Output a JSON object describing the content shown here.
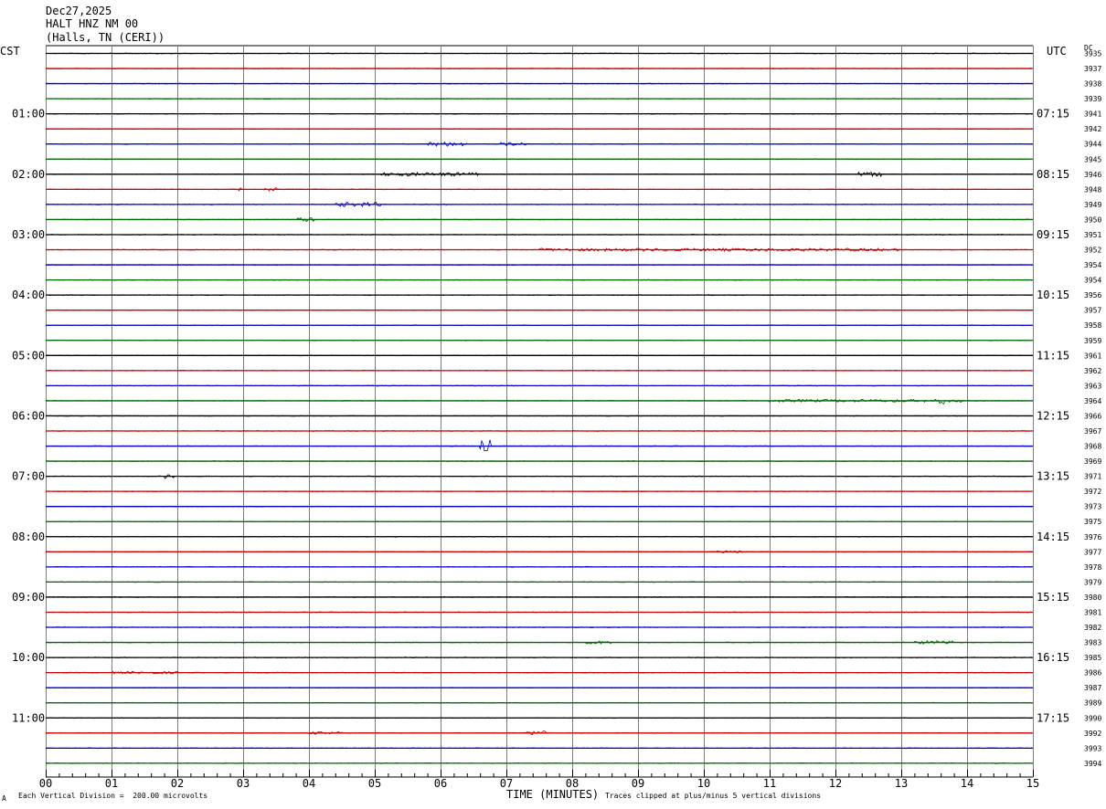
{
  "header": {
    "date": "Dec27,2025",
    "station": "HALT HNZ NM 00",
    "location": "(Halls, TN (CERI))"
  },
  "left_timezone": "CST",
  "right_timezone": "UTC",
  "dc_label": "DC",
  "footer": {
    "scale_note": "Each Vertical Division =  200.00 microvolts",
    "clip_note": "Traces clipped at plus/minus 5 vertical divisions",
    "corner_mark": "A"
  },
  "colors": {
    "trace_cycle": [
      "#000000",
      "#cc0000",
      "#0000cc",
      "#006600"
    ],
    "grid": "#808080"
  },
  "chart_data": {
    "type": "line",
    "title": "HALT HNZ NM 00",
    "xlabel": "TIME (MINUTES)",
    "x_ticks": [
      "00",
      "01",
      "02",
      "03",
      "04",
      "05",
      "06",
      "07",
      "08",
      "09",
      "10",
      "11",
      "12",
      "13",
      "14",
      "15"
    ],
    "xlim": [
      0,
      15
    ],
    "rows": 48,
    "minutes_per_row": 15,
    "left_hour_labels": [
      "01:00",
      "02:00",
      "03:00",
      "04:00",
      "05:00",
      "06:00",
      "07:00",
      "08:00",
      "09:00",
      "10:00",
      "11:00"
    ],
    "right_hour_labels": [
      "07:15",
      "08:15",
      "09:15",
      "10:15",
      "11:15",
      "12:15",
      "13:15",
      "14:15",
      "15:15",
      "16:15",
      "17:15"
    ],
    "dc_offsets": [
      3935,
      3937,
      3938,
      3939,
      3941,
      3942,
      3944,
      3945,
      3946,
      3948,
      3949,
      3950,
      3951,
      3952,
      3954,
      3954,
      3956,
      3957,
      3958,
      3959,
      3961,
      3962,
      3963,
      3964,
      3966,
      3967,
      3968,
      3969,
      3971,
      3972,
      3973,
      3975,
      3976,
      3977,
      3978,
      3979,
      3980,
      3981,
      3982,
      3983,
      3985,
      3986,
      3987,
      3989,
      3990,
      3992,
      3993,
      3994
    ],
    "events": [
      {
        "row": 6,
        "start_min": 5.8,
        "end_min": 6.4,
        "amp_px": 2.5
      },
      {
        "row": 6,
        "start_min": 6.9,
        "end_min": 7.3,
        "amp_px": 2
      },
      {
        "row": 8,
        "start_min": 5.1,
        "end_min": 6.6,
        "amp_px": 2
      },
      {
        "row": 8,
        "start_min": 12.3,
        "end_min": 12.7,
        "amp_px": 2.5
      },
      {
        "row": 9,
        "start_min": 2.93,
        "end_min": 2.97,
        "amp_px": 7
      },
      {
        "row": 9,
        "start_min": 3.3,
        "end_min": 3.5,
        "amp_px": 2
      },
      {
        "row": 10,
        "start_min": 4.4,
        "end_min": 5.1,
        "amp_px": 2.5
      },
      {
        "row": 11,
        "start_min": 3.8,
        "end_min": 4.1,
        "amp_px": 2.5
      },
      {
        "row": 13,
        "start_min": 7.5,
        "end_min": 13.0,
        "amp_px": 1.6
      },
      {
        "row": 23,
        "start_min": 11.0,
        "end_min": 14.0,
        "amp_px": 1.5
      },
      {
        "row": 23,
        "start_min": 13.55,
        "end_min": 13.65,
        "amp_px": 4
      },
      {
        "row": 26,
        "start_min": 6.6,
        "end_min": 6.75,
        "amp_px": 7
      },
      {
        "row": 28,
        "start_min": 1.8,
        "end_min": 1.95,
        "amp_px": 2.5
      },
      {
        "row": 33,
        "start_min": 10.2,
        "end_min": 10.6,
        "amp_px": 1.5
      },
      {
        "row": 39,
        "start_min": 8.2,
        "end_min": 8.6,
        "amp_px": 2
      },
      {
        "row": 39,
        "start_min": 13.2,
        "end_min": 13.8,
        "amp_px": 2
      },
      {
        "row": 41,
        "start_min": 1.0,
        "end_min": 2.0,
        "amp_px": 1.3
      },
      {
        "row": 45,
        "start_min": 4.0,
        "end_min": 4.5,
        "amp_px": 1.5
      },
      {
        "row": 45,
        "start_min": 7.3,
        "end_min": 7.6,
        "amp_px": 2.5
      }
    ]
  }
}
